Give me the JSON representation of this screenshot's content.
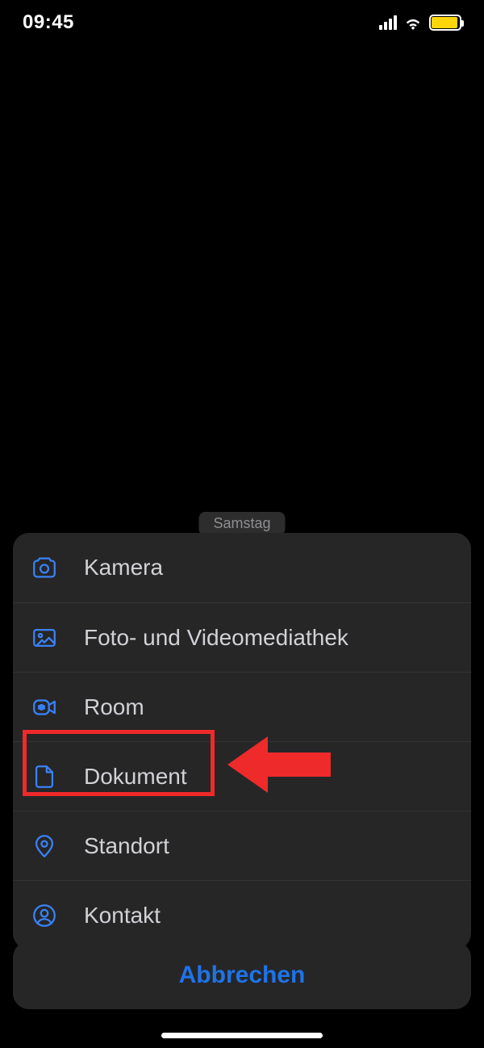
{
  "status": {
    "time": "09:45"
  },
  "day_label": "Samstag",
  "sheet": {
    "items": [
      {
        "label": "Kamera"
      },
      {
        "label": "Foto- und Videomediathek"
      },
      {
        "label": "Room"
      },
      {
        "label": "Dokument"
      },
      {
        "label": "Standort"
      },
      {
        "label": "Kontakt"
      }
    ]
  },
  "cancel_label": "Abbrechen"
}
